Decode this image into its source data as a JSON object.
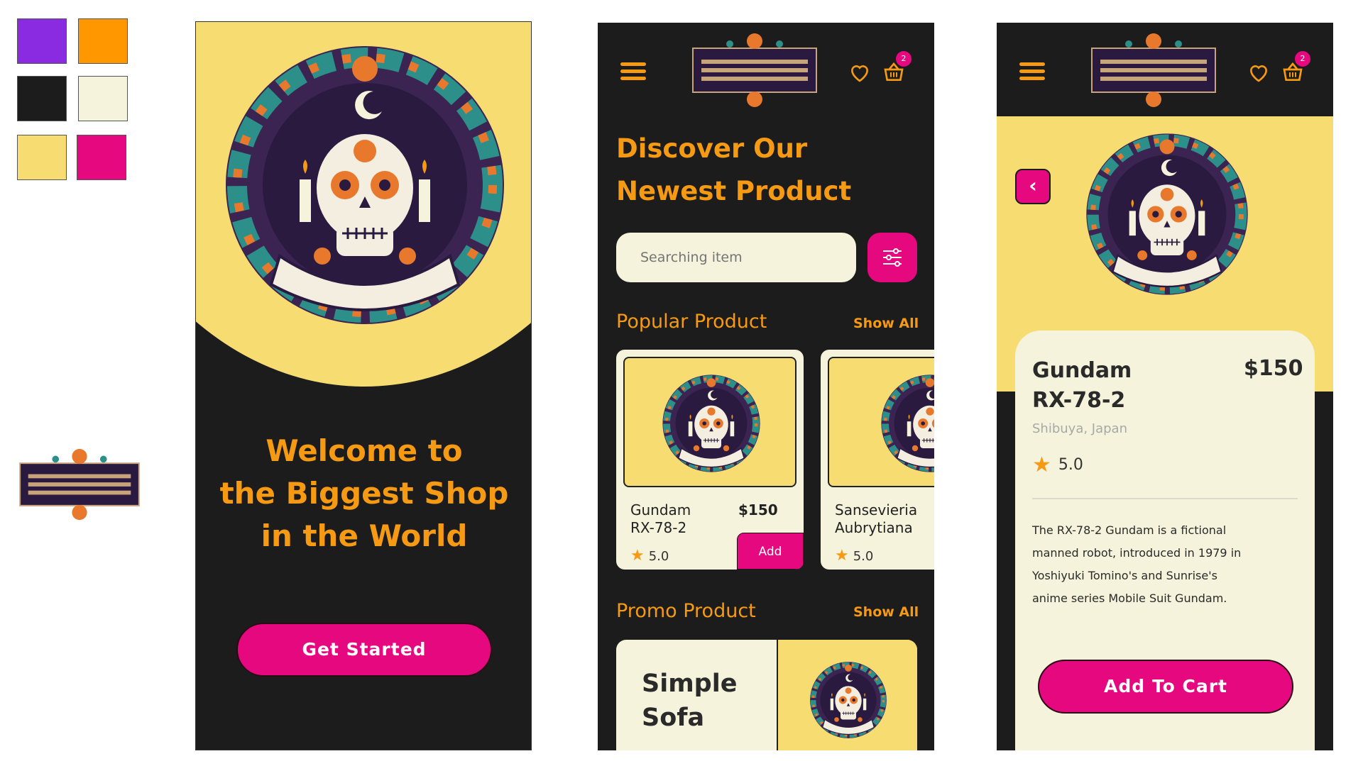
{
  "palette": {
    "colors": [
      "#8a2be2",
      "#ff9800",
      "#1c1c1c",
      "#f5f3dc",
      "#f7dc72",
      "#e5087f"
    ]
  },
  "logo": {
    "icon": "dia-de-muertos-logo"
  },
  "welcome_screen": {
    "heading_line1": "Welcome to",
    "heading_line2": "the Biggest Shop",
    "heading_line3": "in the World",
    "cta_label": "Get Started"
  },
  "header": {
    "menu_icon": "hamburger-menu-icon",
    "heart_icon": "heart-icon",
    "cart_icon": "basket-icon",
    "cart_count": "2"
  },
  "home_screen": {
    "title_line1": "Discover Our",
    "title_line2": "Newest Product",
    "search": {
      "placeholder": "Searching item"
    },
    "popular": {
      "title": "Popular Product",
      "show_all": "Show All",
      "items": [
        {
          "name_line1": "Gundam",
          "name_line2": "RX-78-2",
          "price": "$150",
          "rating": "5.0",
          "button": "Add"
        },
        {
          "name_line1": "Sansevieria",
          "name_line2": "Aubrytiana",
          "rating": "5.0"
        }
      ]
    },
    "promo": {
      "title": "Promo Product",
      "show_all": "Show All",
      "item_line1": "Simple",
      "item_line2": "Sofa"
    }
  },
  "detail_screen": {
    "name_line1": "Gundam",
    "name_line2": "RX-78-2",
    "price": "$150",
    "location": "Shibuya, Japan",
    "rating": "5.0",
    "description_lines": [
      "The RX-78-2 Gundam is a fictional",
      "manned robot, introduced in 1979 in",
      "Yoshiyuki Tomino's and Sunrise's",
      "anime series Mobile Suit Gundam."
    ],
    "cta_label": "Add To Cart"
  }
}
